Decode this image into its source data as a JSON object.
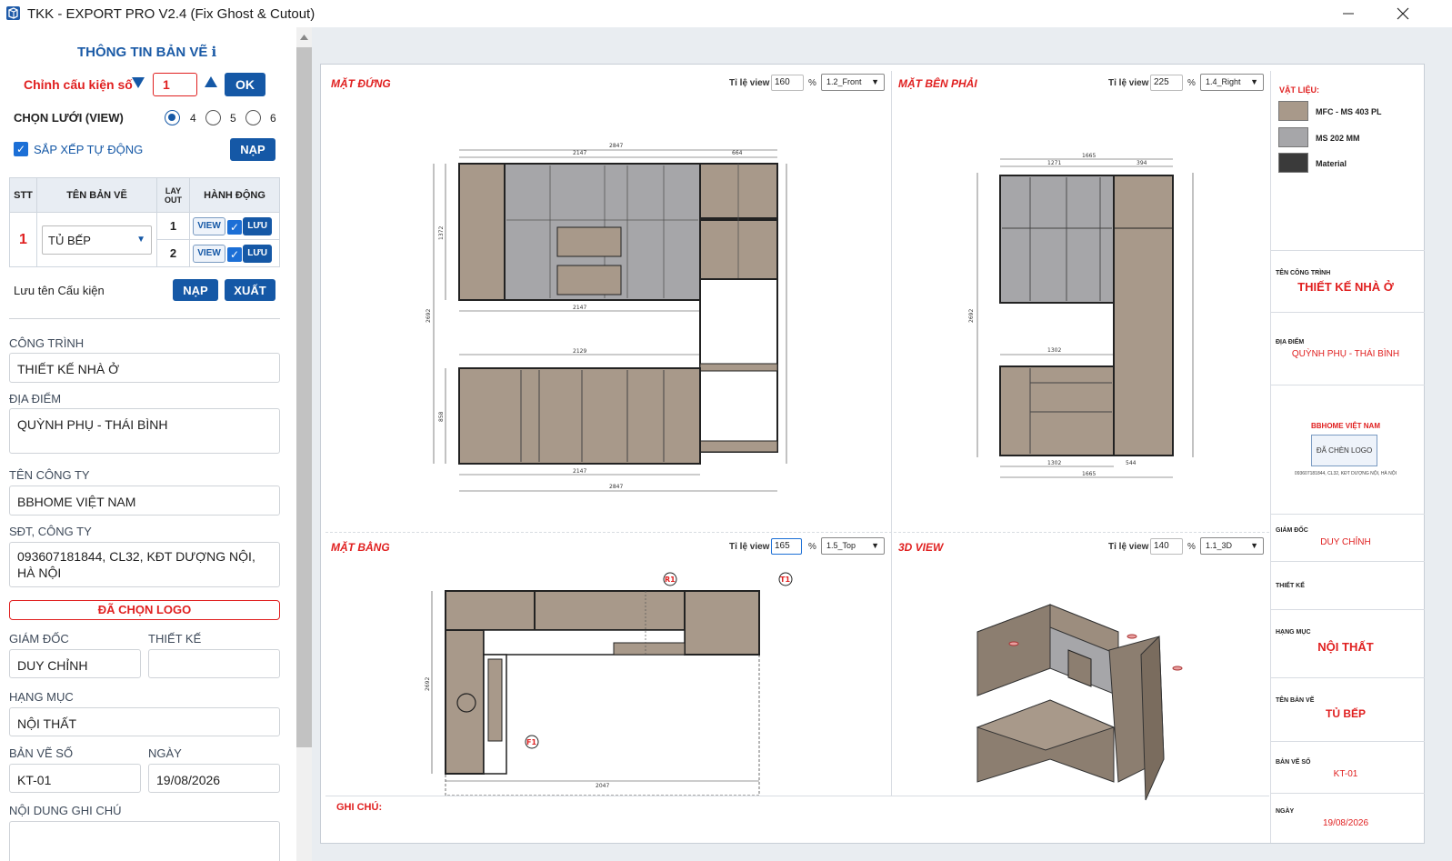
{
  "window": {
    "title": "TKK - EXPORT PRO V2.4 (Fix Ghost & Cutout)"
  },
  "panel": {
    "title": "THÔNG TIN BẢN VẼ ℹ",
    "component_no_label": "Chỉnh cấu kiện số",
    "component_no_value": "1",
    "ok_label": "OK",
    "grid_label": "CHỌN LƯỚI (VIEW)",
    "grid_options": [
      "4",
      "5",
      "6"
    ],
    "grid_selected": "4",
    "auto_arrange_label": "SẮP XẾP TỰ ĐỘNG",
    "load_label": "NẠP",
    "table": {
      "headers": [
        "STT",
        "TÊN BẢN VẼ",
        "LAY OUT",
        "HÀNH ĐỘNG"
      ],
      "row_index": "1",
      "drawing_name": "TỦ BẾP",
      "layouts": [
        {
          "no": "1",
          "view": "VIEW",
          "save": "LƯU"
        },
        {
          "no": "2",
          "view": "VIEW",
          "save": "LƯU"
        }
      ]
    },
    "save_name_label": "Lưu tên Cấu kiện",
    "load_btn2": "NẠP",
    "export_btn": "XUẤT",
    "project_label": "CÔNG TRÌNH",
    "project_value": "THIẾT KẾ NHÀ Ở",
    "location_label": "ĐỊA ĐIỂM",
    "location_value": "QUỲNH PHỤ - THÁI BÌNH",
    "company_label": "TÊN CÔNG TY",
    "company_value": "BBHOME VIỆT NAM",
    "phone_label": "SĐT, CÔNG TY",
    "phone_value": "093607181844, CL32, KĐT DƯỢNG NỘI, HÀ NỘI",
    "logo_btn": "ĐÃ CHỌN LOGO",
    "director_label": "GIÁM ĐỐC",
    "director_value": "DUY CHỈNH",
    "designer_label": "THIẾT KẾ",
    "designer_value": "",
    "category_label": "HẠNG MỤC",
    "category_value": "NỘI THẤT",
    "drawing_no_label": "BẢN VẼ SỐ",
    "drawing_no_value": "KT-01",
    "date_label": "NGÀY",
    "date_value": "19/08/2026",
    "note_label": "NỘI DUNG GHI CHÚ"
  },
  "views": [
    {
      "title": "MẶT ĐỨNG",
      "scale_label": "Tỉ lệ view",
      "scale": "160",
      "pct": "%",
      "scene": "1.2_Front"
    },
    {
      "title": "MẶT BÊN PHẢI",
      "scale_label": "Tỉ lệ view",
      "scale": "225",
      "pct": "%",
      "scene": "1.4_Right"
    },
    {
      "title": "MẶT BẰNG",
      "scale_label": "Tỉ lệ view",
      "scale": "165",
      "pct": "%",
      "scene": "1.5_Top"
    },
    {
      "title": "3D VIEW",
      "scale_label": "Tỉ lệ view",
      "scale": "140",
      "pct": "%",
      "scene": "1.1_3D"
    }
  ],
  "dims": {
    "front_top": "2847",
    "front_top2": "2147",
    "front_top3": "664",
    "front_mid": "2147",
    "front_mid2": "2129",
    "front_bot": "2147",
    "front_bot2": "2847",
    "front_h": "2692",
    "front_h2": "1372",
    "front_h3": "858",
    "right_top": "1665",
    "right_top2": "1271",
    "right_top3": "394",
    "right_mid": "1302",
    "right_bot": "1302",
    "right_bot2": "544",
    "right_bot3": "1665",
    "right_h": "2692",
    "top_w": "2047",
    "top_h": "2692"
  },
  "markers": [
    "R1",
    "T1",
    "F1"
  ],
  "notes_label": "GHI CHÚ:",
  "materials": {
    "label": "VẬT LIỆU:",
    "items": [
      {
        "name": "MFC - MS 403 PL",
        "color": "#a8998a"
      },
      {
        "name": "MS 202 MM",
        "color": "#a6a6a9"
      },
      {
        "name": "Material",
        "color": "#3a3a3a"
      }
    ]
  },
  "titleblock": {
    "project_label": "TÊN CÔNG TRÌNH",
    "project": "THIẾT KẾ NHÀ Ở",
    "location_label": "ĐỊA ĐIỂM",
    "location": "QUỲNH PHỤ - THÁI BÌNH",
    "company": "BBHOME VIỆT NAM",
    "logo_text": "ĐÃ CHÈN LOGO",
    "company_sub": "093607181844, CL32, KĐT DƯỢNG NỘI, HÀ NỘI",
    "director_label": "GIÁM ĐỐC",
    "director": "DUY CHỈNH",
    "designer_label": "THIẾT KẾ",
    "category_label": "HẠNG MỤC",
    "category": "NỘI THẤT",
    "drawing_label": "TÊN BẢN VẼ",
    "drawing": "TỦ BẾP",
    "drawing_no_label": "BẢN VẼ SỐ",
    "drawing_no": "KT-01",
    "date_label": "NGÀY",
    "date": "19/08/2026"
  }
}
